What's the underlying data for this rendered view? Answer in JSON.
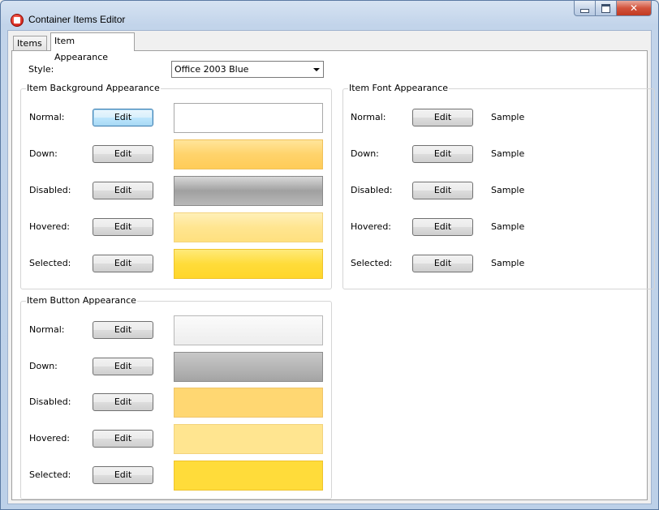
{
  "window": {
    "title": "Container Items Editor"
  },
  "tabs": [
    {
      "label": "Items"
    },
    {
      "label": "Item Appearance"
    }
  ],
  "style": {
    "label": "Style:",
    "value": "Office 2003 Blue"
  },
  "background_group": {
    "title": "Item Background Appearance",
    "rows": [
      {
        "label": "Normal:",
        "button": "Edit"
      },
      {
        "label": "Down:",
        "button": "Edit"
      },
      {
        "label": "Disabled:",
        "button": "Edit"
      },
      {
        "label": "Hovered:",
        "button": "Edit"
      },
      {
        "label": "Selected:",
        "button": "Edit"
      }
    ]
  },
  "font_group": {
    "title": "Item Font Appearance",
    "rows": [
      {
        "label": "Normal:",
        "button": "Edit",
        "sample": "Sample"
      },
      {
        "label": "Down:",
        "button": "Edit",
        "sample": "Sample"
      },
      {
        "label": "Disabled:",
        "button": "Edit",
        "sample": "Sample"
      },
      {
        "label": "Hovered:",
        "button": "Edit",
        "sample": "Sample"
      },
      {
        "label": "Selected:",
        "button": "Edit",
        "sample": "Sample"
      }
    ]
  },
  "button_group": {
    "title": "Item Button Appearance",
    "rows": [
      {
        "label": "Normal:",
        "button": "Edit"
      },
      {
        "label": "Down:",
        "button": "Edit"
      },
      {
        "label": "Disabled:",
        "button": "Edit"
      },
      {
        "label": "Hovered:",
        "button": "Edit"
      },
      {
        "label": "Selected:",
        "button": "Edit"
      }
    ]
  },
  "colors": {
    "disabled_gradient": "#a0a0a0",
    "down_gold": "#ffd36b",
    "hover_light": "#ffe590",
    "selected_yellow": "#ffdc3a"
  },
  "icons": [
    "app-icon",
    "minimize-icon",
    "maximize-icon",
    "close-icon",
    "dropdown-arrow-icon"
  ]
}
